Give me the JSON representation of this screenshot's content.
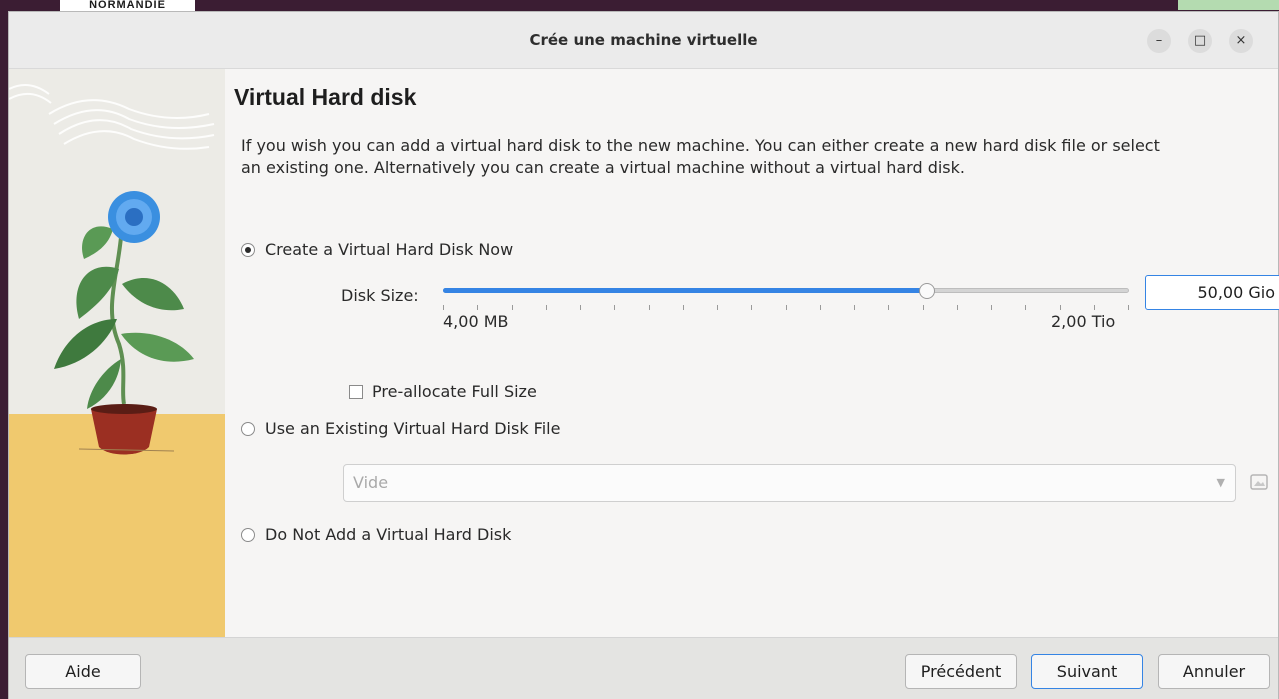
{
  "background": {
    "logo_text": "NORMANDIE"
  },
  "window": {
    "title": "Crée une machine virtuelle",
    "controls": {
      "minimize": "–",
      "maximize": "□",
      "close": "×"
    }
  },
  "page": {
    "heading": "Virtual Hard disk",
    "description": "If you wish you can add a virtual hard disk to the new machine. You can either create a new hard disk file or select an existing one. Alternatively you can create a virtual machine without a virtual hard disk."
  },
  "options": {
    "create_now": {
      "label": "Create a Virtual Hard Disk Now",
      "checked": true
    },
    "use_existing": {
      "label": "Use an Existing Virtual Hard Disk File",
      "checked": false
    },
    "do_not_add": {
      "label": "Do Not Add a Virtual Hard Disk",
      "checked": false
    }
  },
  "disk": {
    "size_label": "Disk Size:",
    "size_value": "50,00 Gio",
    "slider_fraction": 0.706,
    "min_label": "4,00 MB",
    "max_label": "2,00 Tio",
    "preallocate_label": "Pre-allocate Full Size",
    "preallocate_checked": false
  },
  "existing_file": {
    "selected": "Vide"
  },
  "buttons": {
    "help": "Aide",
    "previous": "Précédent",
    "next": "Suivant",
    "cancel": "Annuler"
  },
  "colors": {
    "accent": "#3584e4",
    "sidebar_yellow": "#f0c96e",
    "flower_blue": "#3a8fe0"
  },
  "icons": [
    "minimize-icon",
    "maximize-icon",
    "close-icon",
    "folder-icon",
    "chevron-down-icon"
  ]
}
